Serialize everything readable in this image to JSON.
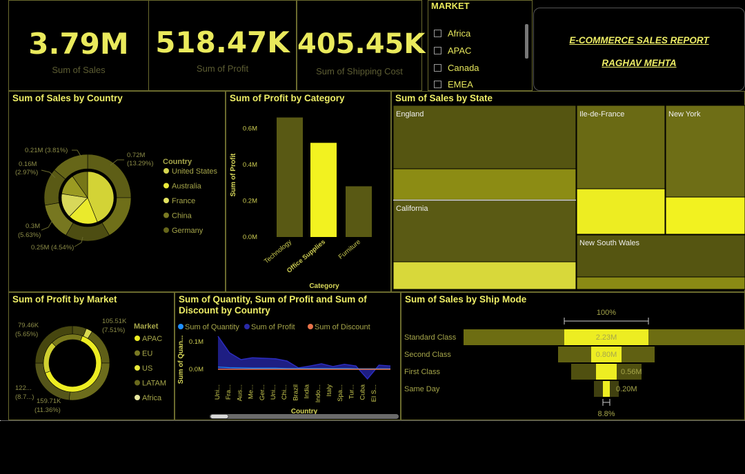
{
  "kpis": [
    {
      "value": "3.79M",
      "label": "Sum of Sales"
    },
    {
      "value": "518.47K",
      "label": "Sum of Profit"
    },
    {
      "value": "405.45K",
      "label": "Sum of Shipping Cost"
    }
  ],
  "slicer": {
    "title": "MARKET",
    "items": [
      "Africa",
      "APAC",
      "Canada",
      "EMEA"
    ]
  },
  "report": {
    "title": "E-COMMERCE SALES REPORT",
    "author": "RAGHAV MEHTA"
  },
  "colors": {
    "accent": "#f2f220",
    "dark_olive": "#555511",
    "olive": "#6e6e18",
    "mid": "#8a8a1c",
    "light": "#d6d640",
    "quantity": "#1e90ff",
    "profit": "#2a2aa8",
    "discount": "#e8734a"
  },
  "chart_data": [
    {
      "type": "pie",
      "id": "sales_by_country",
      "title": "Sum of Sales by Country",
      "legend_title": "Country",
      "legend": [
        "United States",
        "Australia",
        "France",
        "China",
        "Germany"
      ],
      "labels": [
        {
          "value": "0.72M",
          "pct": "(13.29%)"
        },
        {
          "value": "0.25M (4.54%)",
          "pct": ""
        },
        {
          "value": "0.3M",
          "pct": "(5.63%)"
        },
        {
          "value": "0.16M",
          "pct": "(2.97%)"
        },
        {
          "value": "0.21M (3.81%)",
          "pct": ""
        }
      ],
      "inner_values": [
        0.72,
        0.3,
        0.25,
        0.21,
        0.16
      ]
    },
    {
      "type": "bar",
      "id": "profit_by_category",
      "title": "Sum of Profit by Category",
      "categories": [
        "Technology",
        "Office Supplies",
        "Furniture"
      ],
      "values": [
        0.66,
        0.52,
        0.28
      ],
      "xlabel": "Category",
      "ylabel": "Sum of Profit",
      "ylim": [
        0,
        0.7
      ],
      "yticks": [
        "0.0M",
        "0.2M",
        "0.4M",
        "0.6M"
      ],
      "ytick_values": [
        0,
        0.2,
        0.4,
        0.6
      ],
      "highlight": "Office Supplies"
    },
    {
      "type": "heatmap",
      "id": "sales_by_state",
      "title": "Sum of Sales by State",
      "tiles": [
        "England",
        "California",
        "Ile-de-France",
        "New York",
        "New South Wales"
      ]
    },
    {
      "type": "pie",
      "id": "profit_by_market",
      "title": "Sum of Profit by Market",
      "legend_title": "Market",
      "legend": [
        "APAC",
        "EU",
        "US",
        "LATAM",
        "Africa"
      ],
      "labels": [
        {
          "value": "105.51K",
          "pct": "(7.51%)"
        },
        {
          "value": "159.71K",
          "pct": "(11.36%)"
        },
        {
          "value": "122...",
          "pct": "(8.7...)"
        },
        {
          "value": "79.46K",
          "pct": "(5.65%)"
        }
      ]
    },
    {
      "type": "line",
      "id": "qty_profit_discount_by_country",
      "title_line1": "Sum of Quantity, Sum of Profit and Sum of",
      "title_line2": "Discount by Country",
      "series": [
        {
          "name": "Sum of Quantity",
          "values": [
            0.008,
            0.006,
            0.005,
            0.004,
            0.004,
            0.004,
            0.003,
            0.003,
            0.003,
            0.003,
            0.003,
            0.003,
            0.002,
            0.002,
            0.002,
            0.002
          ]
        },
        {
          "name": "Sum of Profit",
          "values": [
            0.12,
            0.06,
            0.035,
            0.042,
            0.04,
            0.038,
            0.03,
            0.005,
            0.012,
            0.02,
            0.01,
            0.018,
            0.012,
            -0.035,
            0.015,
            0.012
          ]
        },
        {
          "name": "Sum of Discount",
          "values": [
            0.0,
            0.0,
            0.0,
            0.0,
            0.0,
            0.0,
            0.0,
            0.0,
            0.0,
            0.0,
            0.0,
            0.0,
            0.0,
            0.0,
            0.0,
            0.0
          ]
        }
      ],
      "x": [
        "Uni...",
        "Fra...",
        "Aus...",
        "Me...",
        "Ger...",
        "Uni...",
        "Chi...",
        "Brazil",
        "India",
        "Indo...",
        "Italy",
        "Spa...",
        "Tur...",
        "Cuba",
        "El S..."
      ],
      "xlabel": "Country",
      "ylabel": "Sum of Quan...",
      "yticks": [
        "0.1M",
        "0.0M"
      ],
      "ytick_values": [
        0.1,
        0.0
      ],
      "ylim": [
        -0.04,
        0.13
      ]
    },
    {
      "type": "bar",
      "id": "sales_by_ship_mode",
      "title": "Sum of Sales by Ship Mode",
      "categories": [
        "Standard Class",
        "Second Class",
        "First Class",
        "Same Day"
      ],
      "values": [
        2.23,
        0.8,
        0.56,
        0.2
      ],
      "data_labels": [
        "2.23M",
        "0.80M",
        "0.56M",
        "0.20M"
      ],
      "top_label": "100%",
      "bottom_label": "8.8%"
    }
  ]
}
